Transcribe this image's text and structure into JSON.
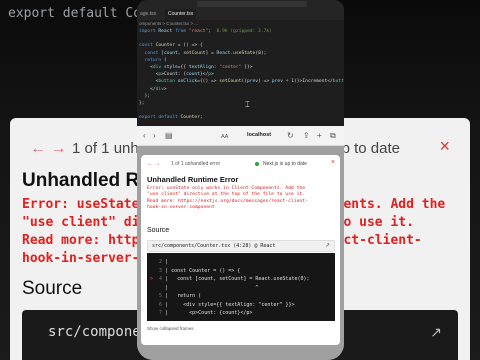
{
  "background": {
    "top_code": "export default Counter;",
    "nav_arrows": "← →",
    "count_text": "1 of 1 unhandled error",
    "uptodate_text": ".js is up to date",
    "close": "×",
    "title": "Unhandled Runtime",
    "err_left": [
      "Error: useState",
      "\"use client\" dire",
      "Read more: https",
      "hook-in-server-co"
    ],
    "err_right": [
      "ponents. Add the",
      "s to use it.",
      "react-client-",
      ""
    ],
    "source_heading": "Source",
    "code_text": "src/componen",
    "open_icon": "↗"
  },
  "editor": {
    "tabs": [
      "age.tsx",
      "Counter.tsx"
    ],
    "breadcrumb": "omponents > Counter.tsx > ...",
    "lines": [
      [
        "import React from \"react\";  8.9k (gzipped: 3.7k)"
      ],
      [
        ""
      ],
      [
        "const Counter = () => {"
      ],
      [
        "  const [count, setCount] = React.useState(0);"
      ],
      [
        "  return ("
      ],
      [
        "    <div style={{ textAlign: \"center\" }}>"
      ],
      [
        "      <p>Count: {count}</p>"
      ],
      [
        "      <button onClick={() => setCount((prev) => prev + 1)}>Increment</button>"
      ],
      [
        "    </div>"
      ],
      [
        "  );"
      ],
      [
        "};"
      ],
      [
        ""
      ],
      [
        "export default Counter;"
      ]
    ]
  },
  "browser": {
    "aa": "AA",
    "url": "localhost",
    "reload": "↻"
  },
  "dialog": {
    "nav": "← →",
    "count_text": "1 of 1 unhandled error",
    "uptodate_text": "Next.js is up to date",
    "close": "×",
    "title": "Unhandled Runtime Error",
    "error_lines": [
      "Error: useState only works in Client Components. Add the",
      "\"use client\" directive at the top of the file to use it.",
      "Read more: https://nextjs.org/docs/messages/react-client-",
      "hook-in-server-component"
    ],
    "source_heading": "Source",
    "file_label": "src/components/Counter.tsx (4:28) @ React",
    "open_icon": "↗",
    "code_lines": [
      {
        "num": "2",
        "marker": " ",
        "text": "|"
      },
      {
        "num": "3",
        "marker": " ",
        "text": "| const Counter = () => {"
      },
      {
        "num": "4",
        "marker": ">",
        "text": "|   const [count, setCount] = React.useState(0);"
      },
      {
        "num": "",
        "marker": " ",
        "text": "|                             ^"
      },
      {
        "num": "5",
        "marker": " ",
        "text": "|   return ("
      },
      {
        "num": "6",
        "marker": " ",
        "text": "|     <div style={{ textAlign: \"center\" }}>"
      },
      {
        "num": "7",
        "marker": " ",
        "text": "|       <p>Count: {count}</p>"
      }
    ],
    "footer": "Show collapsed frames"
  }
}
